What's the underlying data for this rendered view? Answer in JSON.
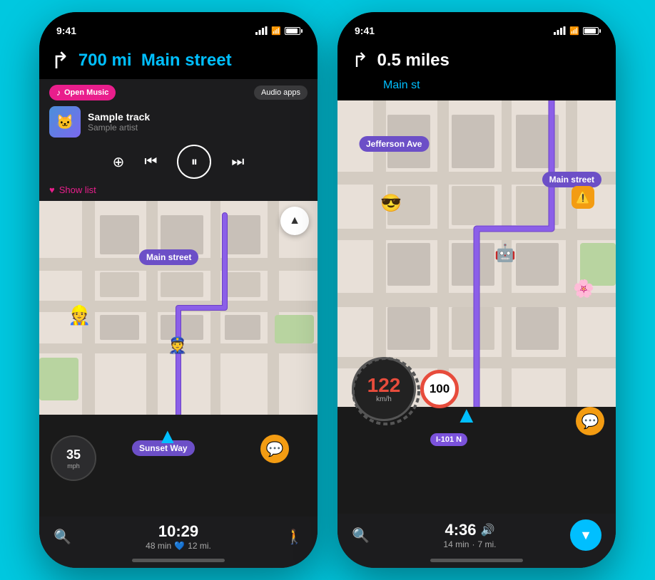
{
  "background_color": "#00c8e0",
  "phone1": {
    "status": {
      "time": "9:41",
      "signal": true,
      "wifi": true,
      "battery": true
    },
    "nav_header": {
      "distance": "700 mi",
      "street": "Main street",
      "turn_symbol": "↱"
    },
    "music": {
      "open_music_label": "Open Music",
      "audio_apps_label": "Audio apps",
      "track_name": "Sample track",
      "artist_name": "Sample artist",
      "show_list_label": "Show list"
    },
    "map": {
      "street_label": "Main street",
      "sunset_label": "Sunset Way",
      "speed": "35",
      "speed_unit": "mph"
    },
    "bottom_bar": {
      "time": "10:29",
      "eta": "48 min",
      "distance": "12 mi."
    }
  },
  "phone2": {
    "status": {
      "time": "9:41"
    },
    "nav_header": {
      "distance": "0.5 miles",
      "street": "Main st",
      "turn_symbol": "↱"
    },
    "map": {
      "main_street_label": "Main street",
      "jefferson_label": "Jefferson Ave",
      "route_label": "I-101 N",
      "current_speed": "122",
      "current_speed_unit": "km/h",
      "speed_limit": "100"
    },
    "bottom_bar": {
      "time": "4:36",
      "eta": "14 min",
      "distance": "7 mi."
    }
  }
}
